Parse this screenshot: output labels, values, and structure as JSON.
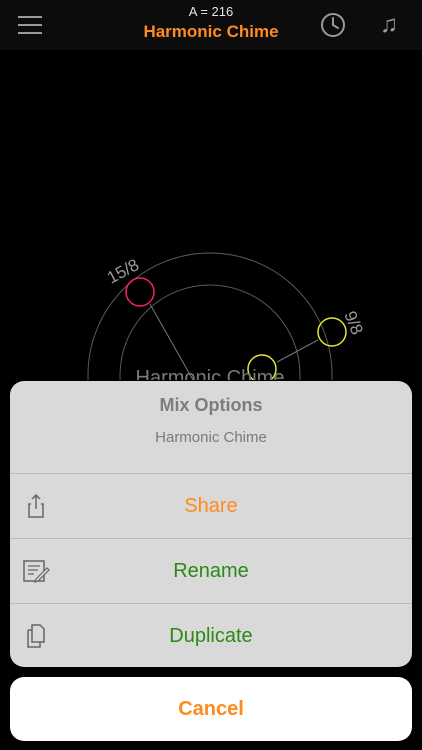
{
  "header": {
    "subtitle": "A = 216",
    "title": "Harmonic Chime",
    "icons": [
      "hamburger-menu-icon",
      "clock-icon",
      "music-note-icon"
    ]
  },
  "visual": {
    "center_label": "Harmonic Chime",
    "nodes": [
      {
        "label": "15/8",
        "color": "#ff1f6b"
      },
      {
        "label": "9/8",
        "color": "#e6e63a"
      },
      {
        "label": "",
        "color": "#e6e63a"
      }
    ]
  },
  "action_sheet": {
    "title": "Mix Options",
    "subtitle": "Harmonic Chime",
    "actions": [
      {
        "label": "Share",
        "icon": "share-icon",
        "color": "#ff8a1f"
      },
      {
        "label": "Rename",
        "icon": "rename-icon",
        "color": "#2a8a14"
      },
      {
        "label": "Duplicate",
        "icon": "duplicate-icon",
        "color": "#2a8a14"
      }
    ],
    "cancel": "Cancel"
  },
  "colors": {
    "accent": "#ff8a1f",
    "green": "#2a8a14",
    "sheet_bg": "#d9d9d9"
  }
}
